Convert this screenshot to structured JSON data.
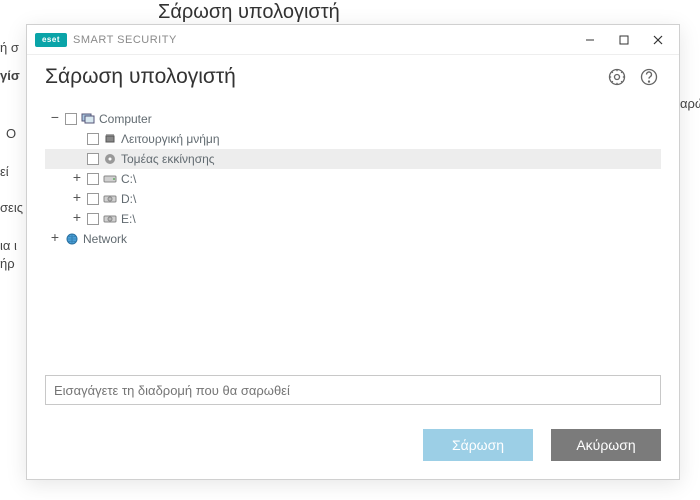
{
  "bg": {
    "title": "Σάρωση υπολογιστή",
    "frag1": "ή σ",
    "frag2": "γίσ",
    "frag3": "Ο",
    "frag4": "εί",
    "frag5": "σεις",
    "frag6": "ια ι",
    "frag7": "ήρ",
    "frag8": "αρώ"
  },
  "titlebar": {
    "brand": "eset",
    "product": "SMART SECURITY"
  },
  "header": {
    "title": "Σάρωση υπολογιστή"
  },
  "tree": {
    "computer": "Computer",
    "memory": "Λειτουργική μνήμη",
    "boot": "Τομέας εκκίνησης",
    "driveC": "C:\\",
    "driveD": "D:\\",
    "driveE": "E:\\",
    "network": "Network"
  },
  "footer": {
    "placeholder": "Εισαγάγετε τη διαδρομή που θα σαρωθεί",
    "scan": "Σάρωση",
    "cancel": "Ακύρωση"
  }
}
